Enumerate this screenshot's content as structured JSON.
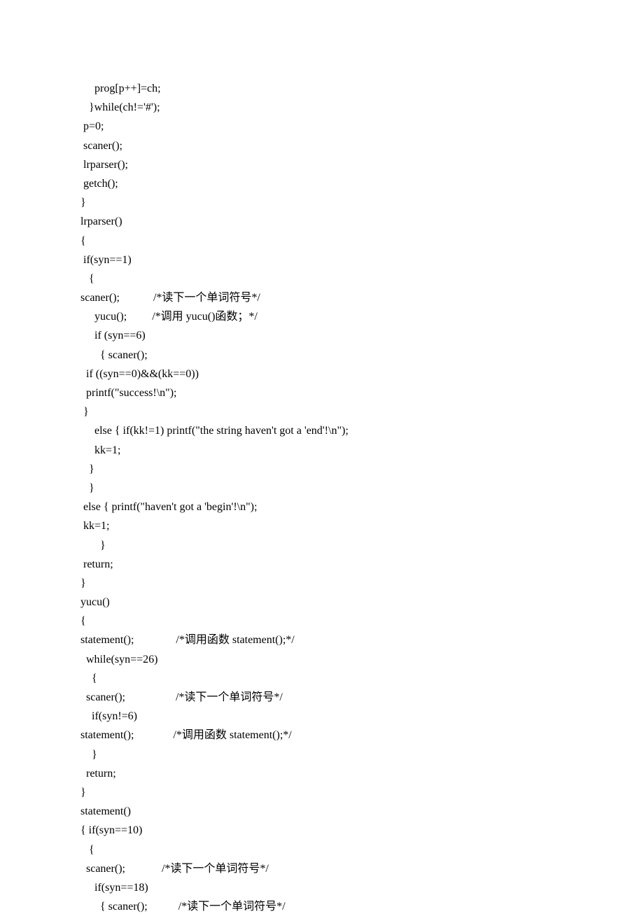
{
  "lines": [
    "     prog[p++]=ch;",
    "   }while(ch!='#');",
    " p=0;",
    " scaner();",
    " lrparser();",
    " getch();",
    "}",
    "lrparser()",
    "{",
    " if(syn==1)",
    "   {",
    "scaner();            /*读下一个单词符号*/",
    "     yucu();         /*调用 yucu()函数；*/",
    "     if (syn==6)",
    "       { scaner();",
    "  if ((syn==0)&&(kk==0))",
    "  printf(\"success!\\n\");",
    " }",
    "     else { if(kk!=1) printf(\"the string haven't got a 'end'!\\n\");",
    "     kk=1;",
    "   }",
    "   }",
    " else { printf(\"haven't got a 'begin'!\\n\");",
    " kk=1;",
    "       }",
    " return;",
    "}",
    "yucu()",
    "{",
    "statement();               /*调用函数 statement();*/",
    "  while(syn==26)",
    "    {",
    "  scaner();                  /*读下一个单词符号*/",
    "    if(syn!=6)",
    "statement();              /*调用函数 statement();*/",
    "    }",
    "  return;",
    "}",
    "statement()",
    "{ if(syn==10)",
    "   {",
    "  scaner();             /*读下一个单词符号*/",
    "     if(syn==18)",
    "       { scaner();           /*读下一个单词符号*/"
  ]
}
